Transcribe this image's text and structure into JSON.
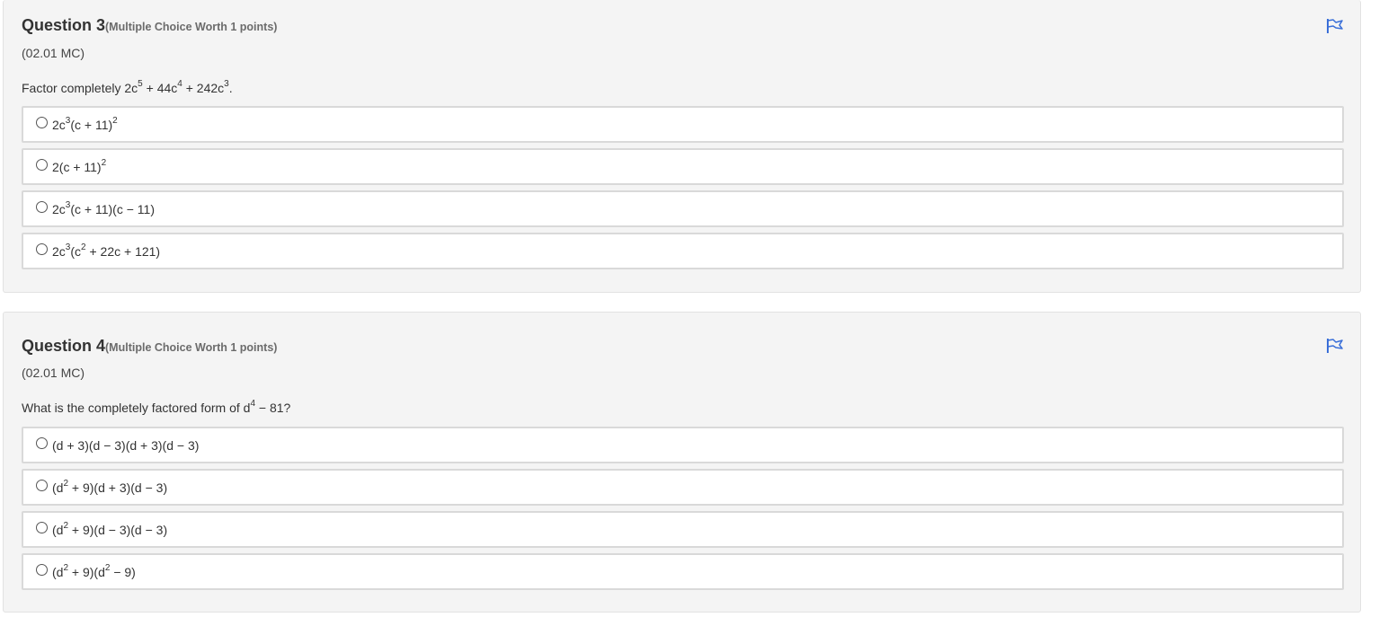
{
  "questions": [
    {
      "title": "Question 3",
      "meta": "(Multiple Choice Worth 1 points)",
      "code": "(02.01 MC)",
      "prompt": {
        "p1": "Factor completely 2c",
        "e1": "5",
        "p2": " + 44c",
        "e2": "4",
        "p3": " + 242c",
        "e3": "3",
        "p4": "."
      },
      "flag_icon": "flag-icon",
      "choices": [
        {
          "a": "2c",
          "sa": "3",
          "b": "(c + 11)",
          "sb": "2",
          "c": ""
        },
        {
          "a": "2(c + 11)",
          "sa": "2",
          "b": "",
          "sb": "",
          "c": ""
        },
        {
          "a": "2c",
          "sa": "3",
          "b": "(c + 11)(c − 11)",
          "sb": "",
          "c": ""
        },
        {
          "a": "2c",
          "sa": "3",
          "b": "(c",
          "sb": "2",
          "c": " + 22c + 121)"
        }
      ]
    },
    {
      "title": "Question 4",
      "meta": "(Multiple Choice Worth 1 points)",
      "code": "(02.01 MC)",
      "prompt": {
        "p1": "What is the completely factored form of d",
        "e1": "4",
        "p2": " − 81?"
      },
      "flag_icon": "flag-icon",
      "choices": [
        {
          "a": "(d + 3)(d − 3)(d + 3)(d − 3)",
          "sa": "",
          "b": "",
          "sb": "",
          "c": ""
        },
        {
          "a": "(d",
          "sa": "2",
          "b": " + 9)(d + 3)(d − 3)",
          "sb": "",
          "c": ""
        },
        {
          "a": "(d",
          "sa": "2",
          "b": " + 9)(d − 3)(d − 3)",
          "sb": "",
          "c": ""
        },
        {
          "a": "(d",
          "sa": "2",
          "b": " + 9)(d",
          "sb": "2",
          "c": " − 9)"
        }
      ]
    }
  ],
  "colors": {
    "card_bg": "#f4f4f4",
    "flag": "#3a6fd8",
    "choice_border": "#d9d9d9"
  }
}
